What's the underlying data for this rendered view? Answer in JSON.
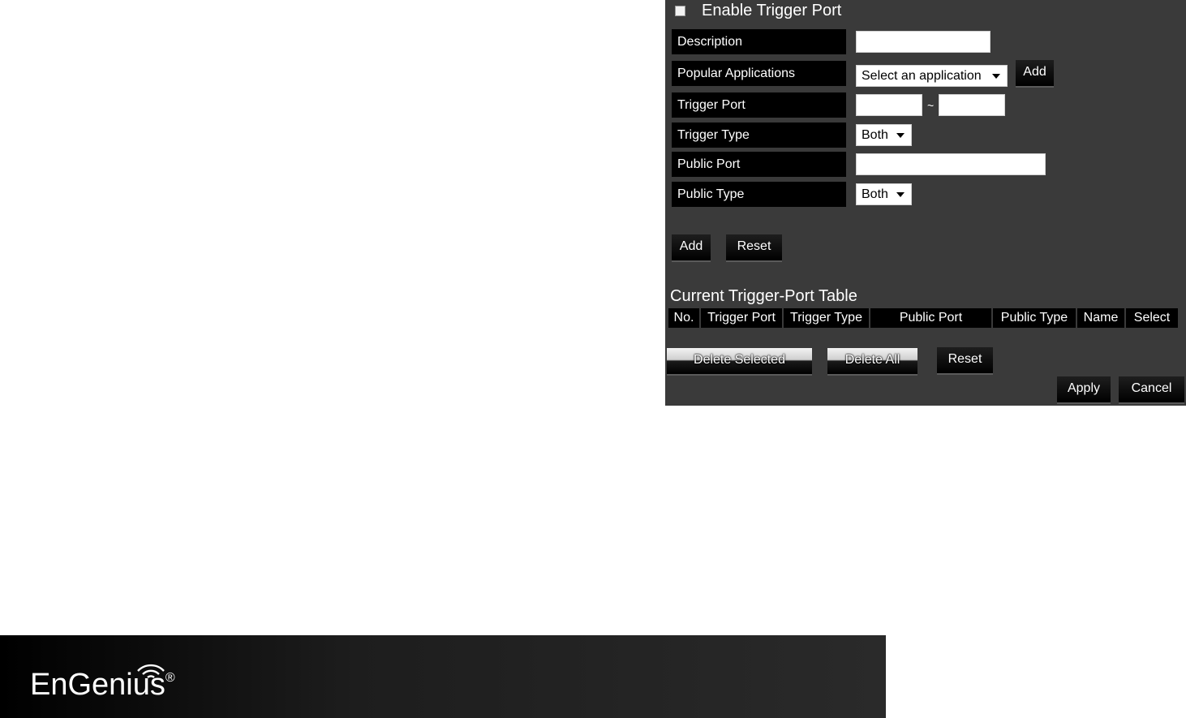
{
  "form": {
    "enable_label": "Enable Trigger Port",
    "enable_checked": false,
    "fields": {
      "description": "Description",
      "popular_applications": "Popular Applications",
      "trigger_port": "Trigger Port",
      "trigger_type": "Trigger Type",
      "public_port": "Public Port",
      "public_type": "Public Type"
    },
    "description_value": "",
    "app_select_value": "Select an application",
    "app_add_button": "Add",
    "trigger_port_from": "",
    "trigger_port_sep": "~",
    "trigger_port_to": "",
    "trigger_type_value": "Both",
    "public_port_value": "",
    "public_type_value": "Both",
    "add_button": "Add",
    "reset_button": "Reset"
  },
  "table": {
    "title": "Current Trigger-Port Table",
    "columns": [
      "No.",
      "Trigger Port",
      "Trigger Type",
      "Public Port",
      "Public Type",
      "Name",
      "Select"
    ],
    "rows": []
  },
  "actions": {
    "delete_selected": "Delete Selected",
    "delete_all": "Delete All",
    "reset": "Reset",
    "apply": "Apply",
    "cancel": "Cancel"
  },
  "footer": {
    "logo_text": "EnGenius",
    "logo_mark": "®"
  },
  "colors": {
    "panel_bg": "#3a3a3a",
    "label_bg": "#000000",
    "text": "#ffffff"
  },
  "icons": {
    "dropdown": "caret-down-icon",
    "logo_wifi": "wifi-icon"
  }
}
